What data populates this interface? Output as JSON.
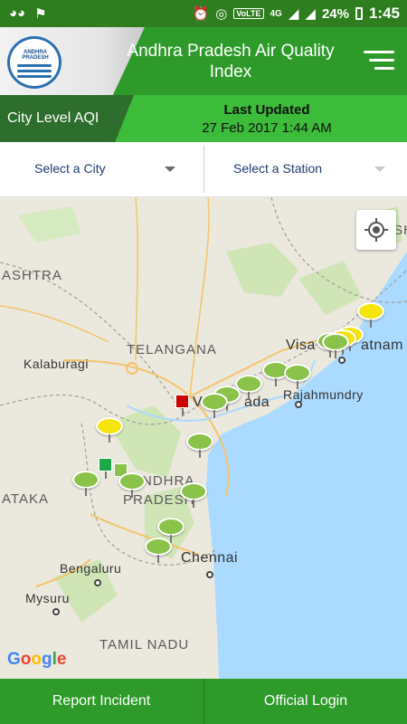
{
  "status_bar": {
    "network_label": "4G",
    "volte_label": "VoLTE",
    "battery": "24%",
    "time": "1:45"
  },
  "header": {
    "title": "Andhra Pradesh Air Quality Index",
    "logo_text": "ANDHRA PRADESH"
  },
  "subbar": {
    "city_level": "City Level AQI",
    "last_updated_label": "Last Updated",
    "last_updated_value": "27 Feb 2017 1:44 AM"
  },
  "filters": {
    "city_placeholder": "Select a City",
    "station_placeholder": "Select a Station"
  },
  "map": {
    "labels": {
      "ashtra": "ASHTRA",
      "telangana": "TELANGANA",
      "kalaburagi": "Kalaburagi",
      "visakhapatnam_a": "Visa",
      "visakhapatnam_b": "atnam",
      "vijayawada_a": "V",
      "vijayawada_b": "ada",
      "rajahmundry": "Rajahmundry",
      "andhra": "ANDHRA",
      "pradesh": "PRADESH",
      "ataka": "ATAKA",
      "bengaluru": "Bengaluru",
      "chennai": "Chennai",
      "mysuru": "Mysuru",
      "tamil_nadu": "TAMIL NADU",
      "odisha_partial": "ISH",
      "google": "Google"
    },
    "aqi_colors": {
      "good": "#8bc34a",
      "moderate": "#f5e50c",
      "severe": "#cc0000",
      "satisfactory": "#1aa84b"
    }
  },
  "footer": {
    "report_incident": "Report Incident",
    "official_login": "Official Login"
  }
}
